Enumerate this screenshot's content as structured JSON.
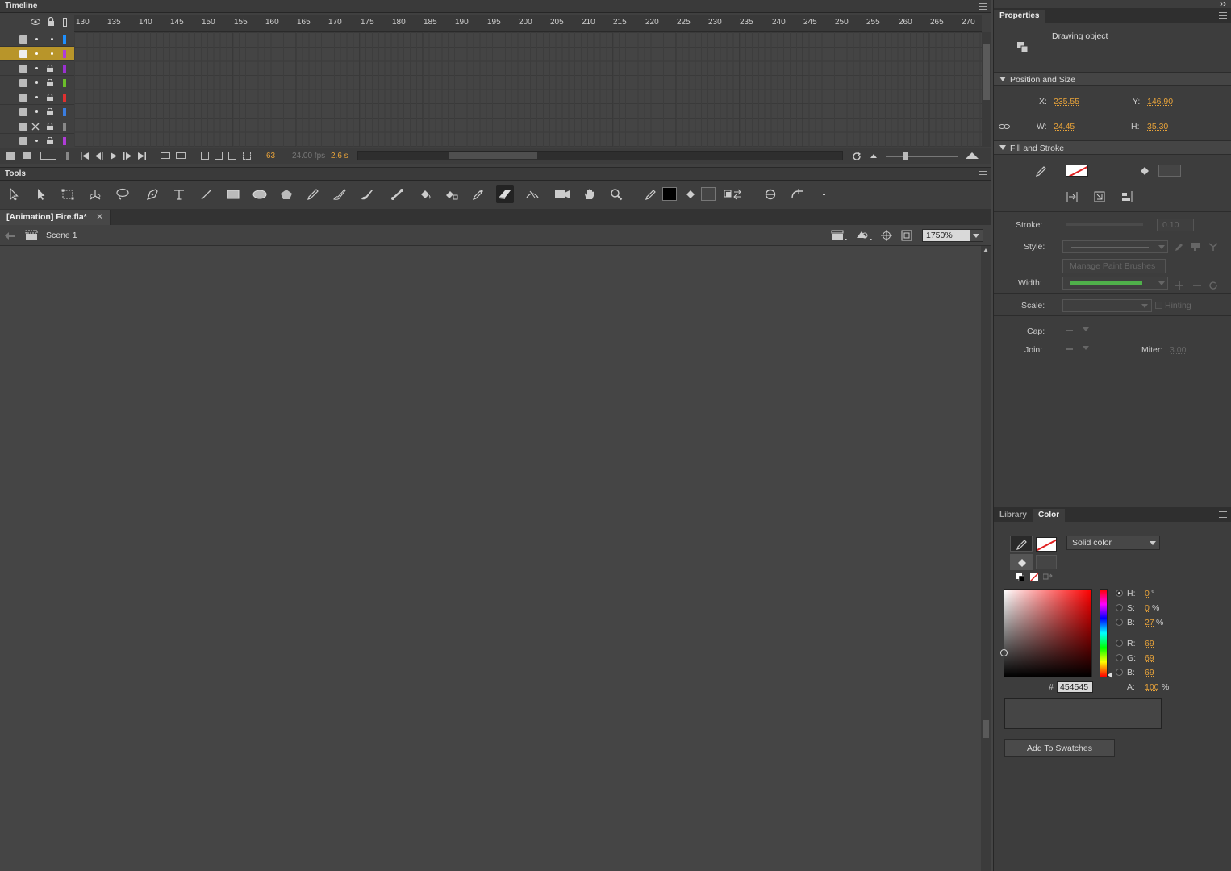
{
  "timeline": {
    "title": "Timeline",
    "ruler_ticks": [
      "130",
      "135",
      "140",
      "145",
      "150",
      "155",
      "160",
      "165",
      "170",
      "175",
      "180",
      "185",
      "190",
      "195",
      "200",
      "205",
      "210",
      "215",
      "220",
      "225",
      "230",
      "235",
      "240",
      "245",
      "250",
      "255",
      "260",
      "265",
      "270"
    ],
    "layer_colors": [
      "#1e90ff",
      "#b03cd8",
      "#9b30d0",
      "#6bbf2a",
      "#e03030",
      "#3a7de0",
      "#888888",
      "#b03cd8"
    ],
    "current_frame": "63",
    "fps": "24.00 fps",
    "elapsed": "2.6 s"
  },
  "tools": {
    "title": "Tools",
    "items": [
      "selection-tool",
      "subselection-tool",
      "free-transform-tool",
      "3d-rotation-tool",
      "lasso-tool",
      "pen-tool",
      "text-tool",
      "line-tool",
      "rectangle-tool",
      "oval-tool",
      "polystar-tool",
      "pencil-tool",
      "paint-brush-tool",
      "brush-tool",
      "bone-tool",
      "paint-bucket-tool",
      "ink-bottle-tool",
      "eyedropper-tool",
      "eraser-tool",
      "width-tool",
      "camera-tool",
      "hand-tool",
      "zoom-tool",
      "stroke-color",
      "fill-color"
    ],
    "selected": "eraser-tool"
  },
  "document": {
    "tab_label": "[Animation] Fire.fla*",
    "scene": "Scene 1",
    "zoom": "1750%"
  },
  "properties": {
    "title": "Properties",
    "object_type": "Drawing object",
    "position_section": "Position and Size",
    "x_label": "X:",
    "x_value": "235.55",
    "y_label": "Y:",
    "y_value": "146.90",
    "w_label": "W:",
    "w_value": "24.45",
    "h_label": "H:",
    "h_value": "35.30",
    "fill_section": "Fill and Stroke",
    "stroke_label": "Stroke:",
    "stroke_value": "0.10",
    "style_label": "Style:",
    "manage_brushes": "Manage Paint Brushes",
    "width_label": "Width:",
    "scale_label": "Scale:",
    "hinting_label": "Hinting",
    "cap_label": "Cap:",
    "join_label": "Join:",
    "miter_label": "Miter:",
    "miter_value": "3.00"
  },
  "color_panel": {
    "tabs": [
      "Library",
      "Color"
    ],
    "active_tab": "Color",
    "type": "Solid color",
    "h_label": "H:",
    "h_value": "0",
    "h_unit": "°",
    "s_label": "S:",
    "s_value": "0",
    "s_unit": "%",
    "b_label": "B:",
    "b_value": "27",
    "b_unit": "%",
    "r_label": "R:",
    "r_value": "69",
    "g_label": "G:",
    "g_value": "69",
    "bl_label": "B:",
    "bl_value": "69",
    "a_label": "A:",
    "a_value": "100",
    "a_unit": "%",
    "hex_label": "#",
    "hex_value": "454545",
    "add_swatches": "Add To Swatches"
  },
  "colors": {
    "accent": "#e8a33a",
    "active_layer": "#b8952a",
    "stage": "#454545"
  }
}
